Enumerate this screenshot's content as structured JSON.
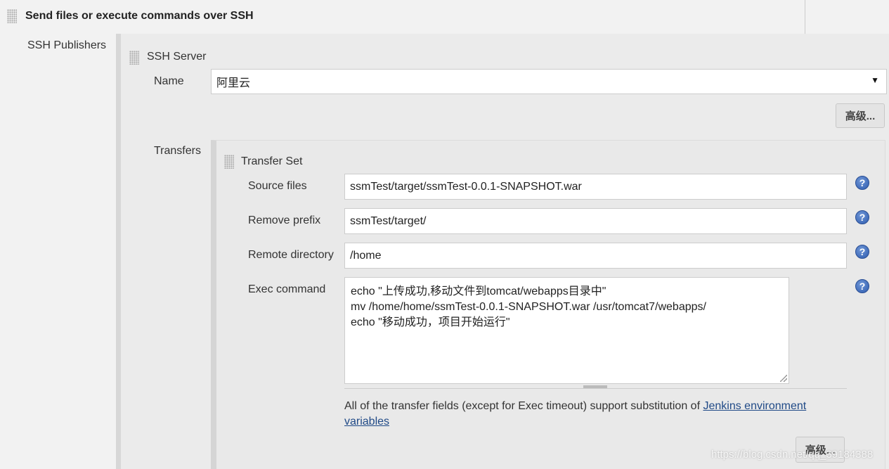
{
  "section": {
    "title": "Send files or execute commands over SSH"
  },
  "publishers": {
    "label": "SSH Publishers"
  },
  "ssh_server": {
    "title": "SSH Server",
    "name_label": "Name",
    "name_value": "阿里云",
    "advanced_label": "高级..."
  },
  "transfers": {
    "label": "Transfers",
    "transfer_set": {
      "title": "Transfer Set",
      "source_files_label": "Source files",
      "source_files_value": "ssmTest/target/ssmTest-0.0.1-SNAPSHOT.war",
      "remove_prefix_label": "Remove prefix",
      "remove_prefix_value": "ssmTest/target/",
      "remote_directory_label": "Remote directory",
      "remote_directory_value": "/home",
      "exec_command_label": "Exec command",
      "exec_command_value": "echo \"上传成功,移动文件到tomcat/webapps目录中\"\nmv /home/home/ssmTest-0.0.1-SNAPSHOT.war /usr/tomcat7/webapps/\necho \"移动成功，项目开始运行\"",
      "note_text": "All of the transfer fields (except for Exec timeout) support substitution of ",
      "note_link": "Jenkins environment variables",
      "advanced_label": "高级..."
    }
  },
  "watermark": "https://blog.csdn.net/qq_39184388"
}
